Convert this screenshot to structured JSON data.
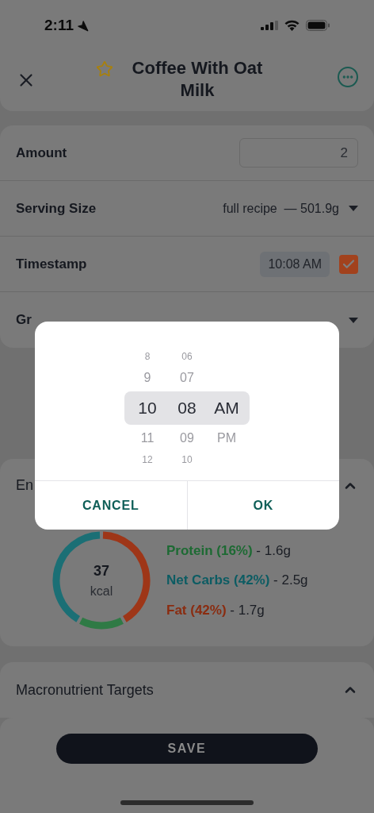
{
  "status_bar": {
    "time": "2:11"
  },
  "header": {
    "title": "Coffee With Oat Milk",
    "favorite": false
  },
  "form": [
    {
      "kind": "input",
      "label": "Amount",
      "value": "2"
    },
    {
      "kind": "select",
      "label": "Serving Size",
      "value": "full recipe  — 501.9g"
    },
    {
      "kind": "time",
      "label": "Timestamp",
      "value": "10:08 AM",
      "checked": true
    },
    {
      "kind": "select",
      "label": "Gr"
    }
  ],
  "energy": {
    "title": "En",
    "expanded": true,
    "total": "37",
    "unit": "kcal",
    "legend": [
      {
        "name": "Protein (16%)",
        "amount": " - 1.6g",
        "color": "#1d6a33"
      },
      {
        "name": "Net Carbs (42%)",
        "amount": " - 2.5g",
        "color": "#0c5c63"
      },
      {
        "name": "Fat (42%)",
        "amount": " - 1.7g",
        "color": "#8a2c10"
      }
    ]
  },
  "targets": {
    "title": "Macronutrient Targets",
    "expanded": true
  },
  "save_button": "SAVE",
  "time_picker": {
    "columns": [
      {
        "items": [
          {
            "label": "8",
            "selected": false
          },
          {
            "label": "9",
            "selected": false
          },
          {
            "label": "10",
            "selected": true
          },
          {
            "label": "11",
            "selected": false
          },
          {
            "label": "12",
            "selected": false
          }
        ]
      },
      {
        "items": [
          {
            "label": "06",
            "selected": false
          },
          {
            "label": "07",
            "selected": false
          },
          {
            "label": "08",
            "selected": true
          },
          {
            "label": "09",
            "selected": false
          },
          {
            "label": "10",
            "selected": false
          }
        ]
      },
      {
        "items": [
          {
            "label": "AM",
            "selected": true
          },
          {
            "label": "PM",
            "selected": false
          }
        ]
      }
    ],
    "buttons": [
      "CANCEL",
      "OK"
    ]
  }
}
